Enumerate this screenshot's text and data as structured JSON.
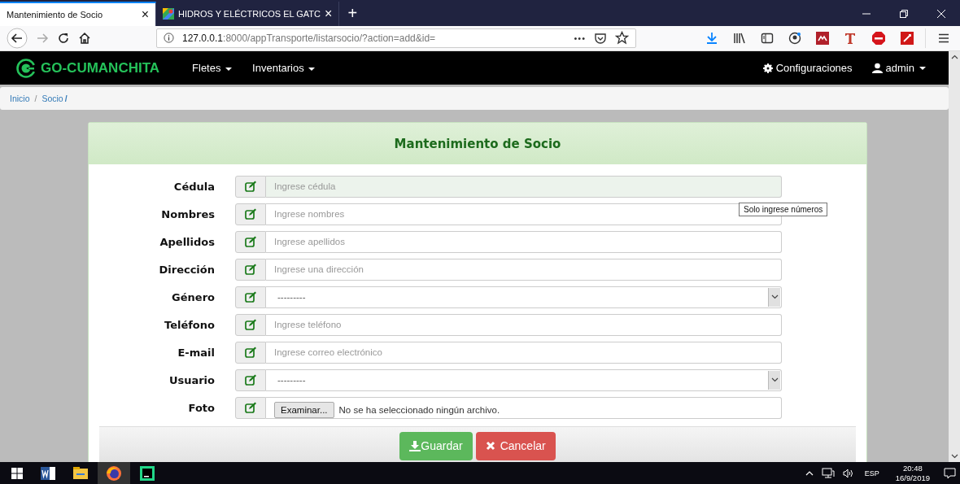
{
  "browser": {
    "tabs": [
      {
        "title": "Mantenimiento de Socio",
        "close": "×",
        "selected": true
      },
      {
        "title": "HIDROS Y ELÉCTRICOS EL GATC",
        "close": "×",
        "selected": false
      }
    ],
    "new_tab": "+",
    "url": {
      "host": "127.0.0.1",
      "path": ":8000/appTransporte/listarsocio/?action=add&id="
    },
    "url_actions": "•••"
  },
  "navbar": {
    "brand": "GO-CUMANCHITA",
    "menus": [
      {
        "label": "Fletes"
      },
      {
        "label": "Inventarios"
      }
    ],
    "settings": "Configuraciones",
    "user": "admin"
  },
  "breadcrumb": [
    {
      "label": "Inicio",
      "separator": "/"
    },
    {
      "label": "Socio",
      "separator": "/"
    }
  ],
  "form": {
    "title": "Mantenimiento de Socio",
    "fields": [
      {
        "kind": "text",
        "label": "Cédula",
        "placeholder": "Ingrese cédula",
        "highlighted": true
      },
      {
        "kind": "text",
        "label": "Nombres",
        "placeholder": "Ingrese nombres",
        "highlighted": false
      },
      {
        "kind": "text",
        "label": "Apellidos",
        "placeholder": "Ingrese apellidos",
        "highlighted": false
      },
      {
        "kind": "text",
        "label": "Dirección",
        "placeholder": "Ingrese una dirección",
        "highlighted": false
      },
      {
        "kind": "select",
        "label": "Género",
        "value": "---------",
        "highlighted": false
      },
      {
        "kind": "text",
        "label": "Teléfono",
        "placeholder": "Ingrese teléfono",
        "highlighted": false
      },
      {
        "kind": "text",
        "label": "E-mail",
        "placeholder": "Ingrese correo electrónico",
        "highlighted": false
      },
      {
        "kind": "select",
        "label": "Usuario",
        "value": "---------",
        "highlighted": false
      },
      {
        "kind": "file",
        "label": "Foto",
        "button": "Examinar...",
        "status": "No se ha seleccionado ningún archivo.",
        "highlighted": false
      }
    ],
    "tooltip": "Solo ingrese números",
    "buttons": [
      {
        "kind": "save",
        "label": "Guardar"
      },
      {
        "kind": "cancel",
        "label": "Cancelar"
      }
    ]
  },
  "taskbar": {
    "language": "ESP",
    "time": "20:48",
    "date": "16/9/2019"
  }
}
